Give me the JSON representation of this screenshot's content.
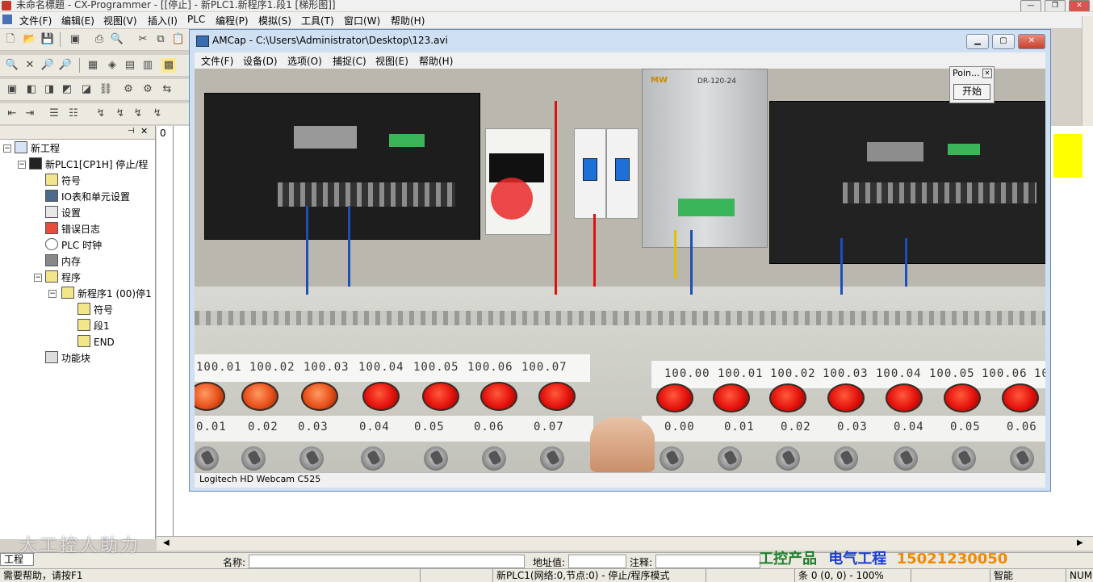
{
  "main_window": {
    "title": "未命名標題 - CX-Programmer - [[停止] - 新PLC1.新程序1.段1 [梯形图]]",
    "menu": [
      "文件(F)",
      "编辑(E)",
      "视图(V)",
      "插入(I)",
      "PLC",
      "编程(P)",
      "模拟(S)",
      "工具(T)",
      "窗口(W)",
      "帮助(H)"
    ]
  },
  "project_tree": {
    "items": [
      {
        "label": "新工程",
        "icon": "project-icon"
      },
      {
        "label": "新PLC1[CP1H] 停止/程",
        "icon": "plc-icon"
      },
      {
        "label": "符号",
        "icon": "symbols-icon"
      },
      {
        "label": "IO表和单元设置",
        "icon": "io-table-icon"
      },
      {
        "label": "设置",
        "icon": "settings-icon"
      },
      {
        "label": "错误日志",
        "icon": "error-log-icon"
      },
      {
        "label": "PLC 时钟",
        "icon": "clock-icon"
      },
      {
        "label": "内存",
        "icon": "memory-icon"
      },
      {
        "label": "程序",
        "icon": "programs-icon"
      },
      {
        "label": "新程序1 (00)停1",
        "icon": "program-icon"
      },
      {
        "label": "符号",
        "icon": "symbols-icon"
      },
      {
        "label": "段1",
        "icon": "section-icon"
      },
      {
        "label": "END",
        "icon": "section-icon"
      },
      {
        "label": "功能块",
        "icon": "function-block-icon"
      }
    ],
    "tab_label": "工程"
  },
  "ladder": {
    "rung_number": "0"
  },
  "info_bar": {
    "name_label": "名称:",
    "address_label": "地址值:",
    "comment_label": "注释:"
  },
  "status_bar": {
    "help": "需要帮助，请按F1",
    "plc_status": "新PLC1(网络:0,节点:0) - 停止/程序模式",
    "position": "条 0 (0, 0)  - 100%",
    "mode": "智能",
    "num": "NUM"
  },
  "amcap": {
    "title": "AMCap - C:\\Users\\Administrator\\Desktop\\123.avi",
    "menu": [
      "文件(F)",
      "设备(D)",
      "选项(O)",
      "捕捉(C)",
      "视图(E)",
      "帮助(H)"
    ],
    "status": "Logitech HD Webcam C525",
    "video": {
      "psu_brand": "MW",
      "psu_model": "DR-120-24",
      "upper_outputs": [
        "100.01",
        "100.02",
        "100.03",
        "100.04",
        "100.05",
        "100.06",
        "100.07"
      ],
      "lower_outputs": [
        "100.00",
        "100.01",
        "100.02",
        "100.03",
        "100.04",
        "100.05",
        "100.06",
        "10"
      ],
      "upper_inputs": [
        "0.01",
        "0.02",
        "0.03",
        "0.04",
        "0.05",
        "0.06",
        "0.07"
      ],
      "lower_inputs": [
        "0.00",
        "0.01",
        "0.02",
        "0.03",
        "0.04",
        "0.05",
        "0.06"
      ]
    }
  },
  "point_popup": {
    "title": "Poin...",
    "start_button": "开始"
  },
  "watermarks": {
    "left": "大工控人助力",
    "right_part1": "工控产品",
    "right_part2": "电气工程",
    "right_phone": "15021230050"
  }
}
